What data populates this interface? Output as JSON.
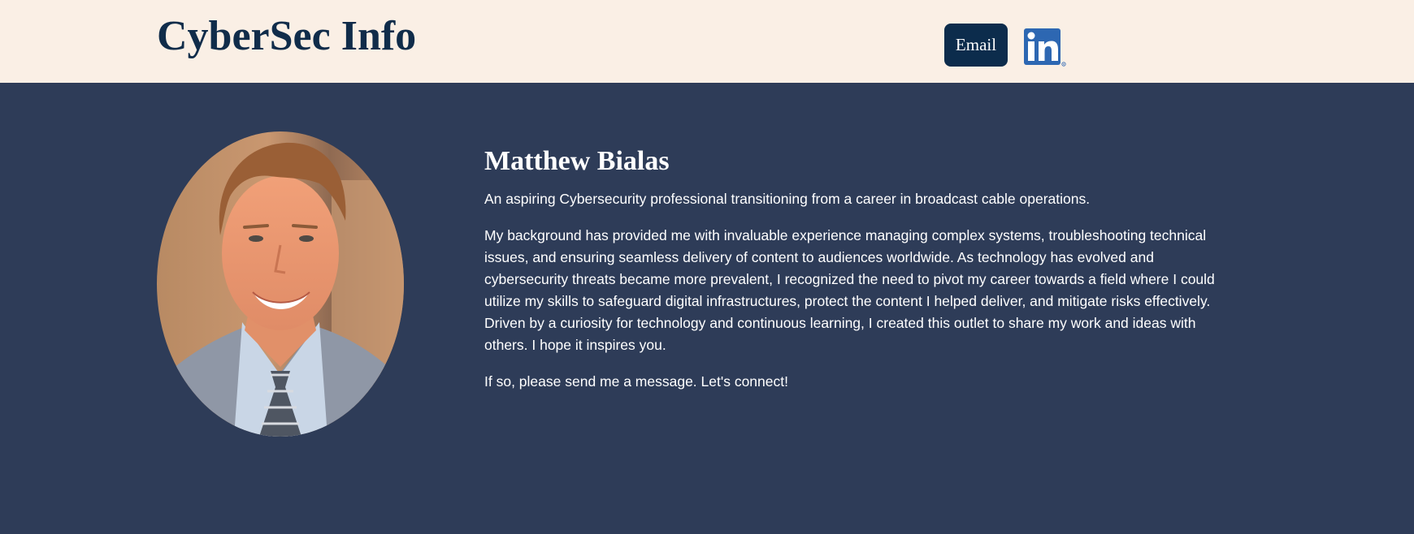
{
  "header": {
    "site_title": "CyberSec Info",
    "email_label": "Email",
    "linkedin_icon": "linkedin-icon"
  },
  "profile": {
    "name": "Matthew Bialas",
    "tagline": "An aspiring Cybersecurity professional transitioning from a career in broadcast cable operations.",
    "background": "My background has provided me with invaluable experience managing complex systems, troubleshooting technical issues, and ensuring seamless delivery of content to audiences worldwide. As technology has evolved and cybersecurity threats became more prevalent, I recognized the need to pivot my career towards a field where I could utilize my skills to safeguard digital infrastructures, protect the content I helped deliver, and mitigate risks effectively. Driven by a curiosity for technology and continuous learning, I created this outlet to share my work and ideas with others. I hope it inspires you.",
    "call_to_action": "If so, please send me a message. Let's connect!"
  },
  "colors": {
    "header_bg": "#faefe5",
    "title_color": "#102c4a",
    "email_button_bg": "#0c2c4c",
    "main_bg": "#2e3c58",
    "linkedin_blue": "#2d67b2"
  }
}
